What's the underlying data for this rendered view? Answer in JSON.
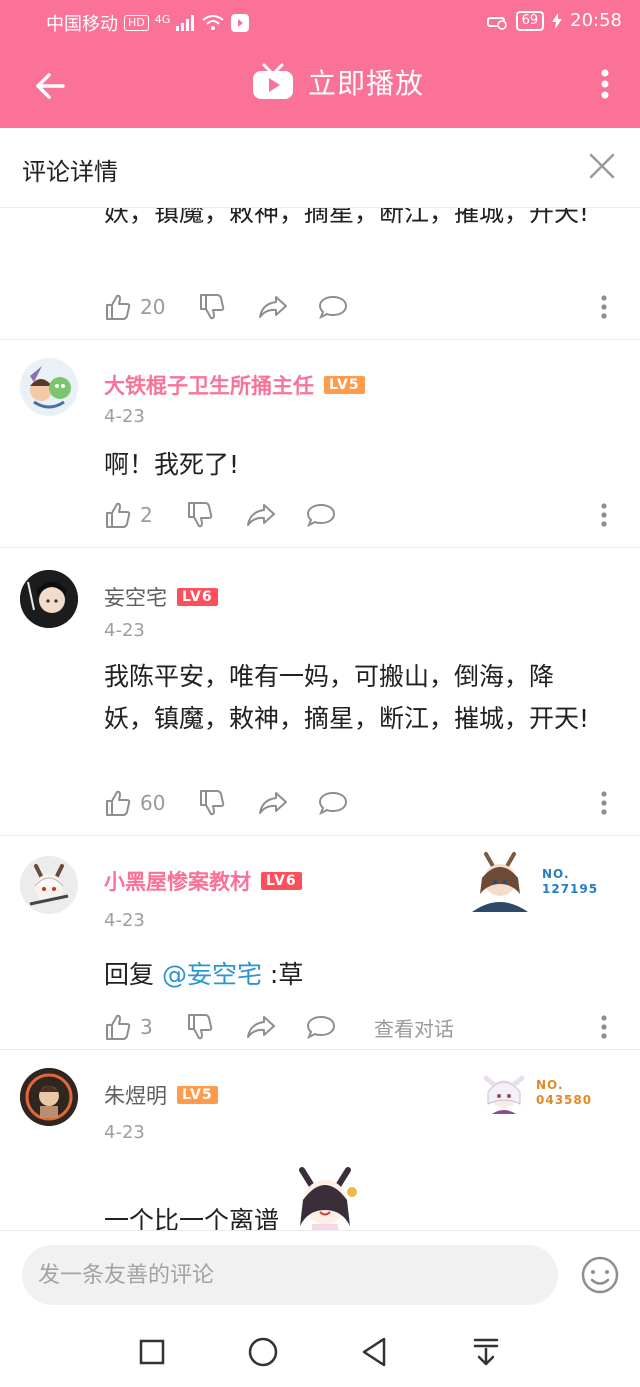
{
  "status_bar": {
    "carrier": "中国移动",
    "hd": "HD",
    "network": "4G",
    "battery": "69",
    "time": "20:58"
  },
  "app_bar": {
    "title": "立即播放"
  },
  "sub_header": {
    "title": "评论详情"
  },
  "comments": [
    {
      "content": "妖，镇魔，敕神，摘星，断江，摧城，开天!",
      "likes": "20"
    },
    {
      "username": "大铁棍子卫生所捅主任",
      "level": "LV5",
      "date": "4-23",
      "content": "啊！我死了!",
      "likes": "2"
    },
    {
      "username": "妄空宅",
      "level": "LV6",
      "date": "4-23",
      "content": "我陈平安，唯有一妈，可搬山，倒海，降妖，镇魔，敕神，摘星，断江，摧城，开天!",
      "likes": "60"
    },
    {
      "username": "小黑屋惨案教材",
      "level": "LV6",
      "date": "4-23",
      "reply_prefix": "回复",
      "mention": "@妄空宅",
      "content": " :草",
      "likes": "3",
      "view_dialog": "查看对话",
      "badge_no": "NO.",
      "badge_number": "127195"
    },
    {
      "username": "朱煜明",
      "level": "LV5",
      "date": "4-23",
      "content": "一个比一个离谱",
      "badge_no": "NO.",
      "badge_number": "043580"
    }
  ],
  "input": {
    "placeholder": "发一条友善的评论"
  },
  "colors": {
    "brand_pink": "#fb7299",
    "mention_blue": "#2a94d2",
    "lv5": "#ff9b4a",
    "lv6": "#ff4f5a"
  }
}
